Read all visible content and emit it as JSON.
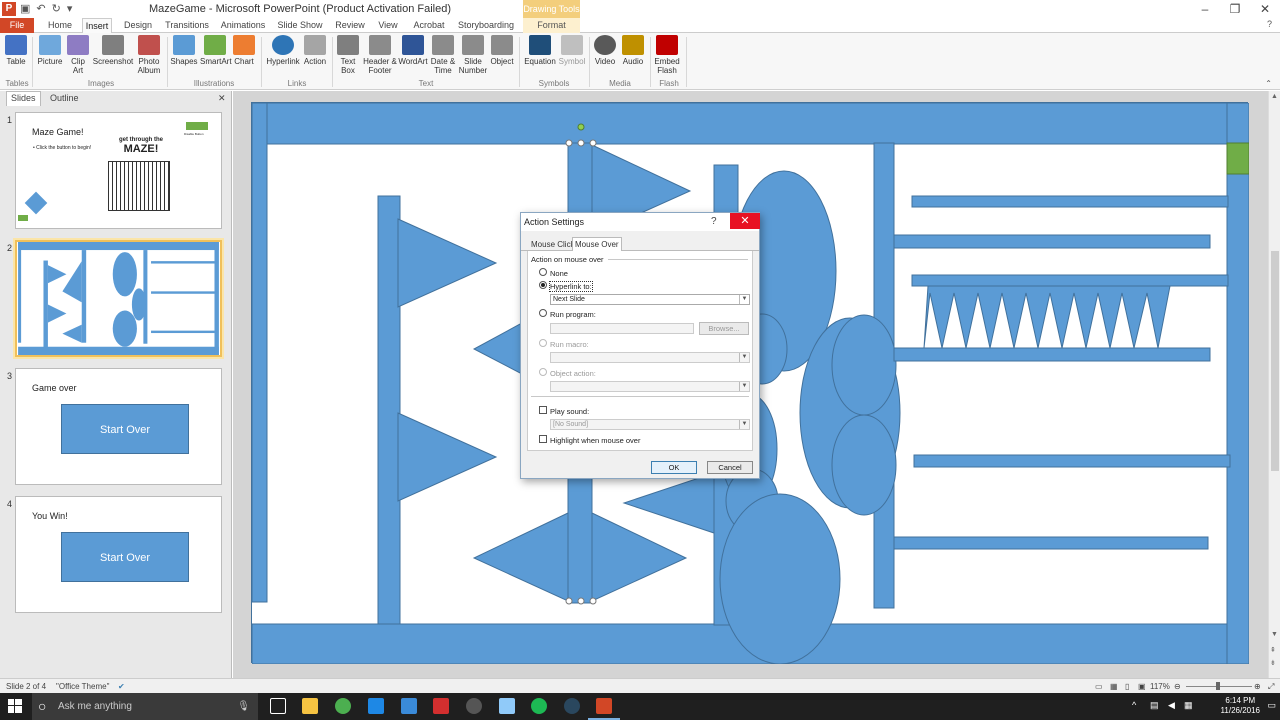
{
  "window": {
    "title": "MazeGame - Microsoft PowerPoint (Product Activation Failed)",
    "drawing_tools": "Drawing Tools",
    "minimize": "–",
    "maximize": "❐",
    "close": "✕"
  },
  "tabs": [
    "File",
    "Home",
    "Insert",
    "Design",
    "Transitions",
    "Animations",
    "Slide Show",
    "Review",
    "View",
    "Acrobat",
    "Storyboarding",
    "Format"
  ],
  "ribbon": {
    "buttons": [
      {
        "label": "Table",
        "color": "#4472c4"
      },
      {
        "label": "Picture",
        "color": "#6fa8dc"
      },
      {
        "label": "Clip Art",
        "color": "#8e7cc3"
      },
      {
        "label": "Screenshot",
        "color": "#7f7f7f"
      },
      {
        "label": "Photo Album",
        "color": "#c0504d"
      },
      {
        "label": "Shapes",
        "color": "#5b9bd5"
      },
      {
        "label": "SmartArt",
        "color": "#70ad47"
      },
      {
        "label": "Chart",
        "color": "#ed7d31"
      },
      {
        "label": "Hyperlink",
        "color": "#2e75b6"
      },
      {
        "label": "Action",
        "color": "#a5a5a5"
      },
      {
        "label": "Text Box",
        "color": "#7f7f7f"
      },
      {
        "label": "Header & Footer",
        "color": "#8b8b8b"
      },
      {
        "label": "WordArt",
        "color": "#2f5597"
      },
      {
        "label": "Date & Time",
        "color": "#8b8b8b"
      },
      {
        "label": "Slide Number",
        "color": "#8b8b8b"
      },
      {
        "label": "Object",
        "color": "#8b8b8b"
      },
      {
        "label": "Equation",
        "color": "#1f4e79"
      },
      {
        "label": "Symbol",
        "color": "#bfbfbf"
      },
      {
        "label": "Video",
        "color": "#595959"
      },
      {
        "label": "Audio",
        "color": "#bf9000"
      },
      {
        "label": "Embed Flash",
        "color": "#c00000"
      }
    ],
    "groups": [
      "Tables",
      "Images",
      "Illustrations",
      "Links",
      "Text",
      "Symbols",
      "Media",
      "Flash"
    ]
  },
  "left_panel": {
    "tabs": [
      "Slides",
      "Outline"
    ],
    "close": "✕",
    "slides": [
      {
        "num": "1",
        "title": "Maze Game!",
        "bullet": "• Click the button to begin!",
        "banner1": "get through the",
        "banner2": "MAZE!",
        "note": "Disable Button"
      },
      {
        "num": "2"
      },
      {
        "num": "3",
        "title": "Game over",
        "button": "Start Over"
      },
      {
        "num": "4",
        "title": "You Win!",
        "button": "Start Over"
      }
    ]
  },
  "dialog": {
    "title": "Action Settings",
    "help": "?",
    "close": "✕",
    "tabs": [
      "Mouse Click",
      "Mouse Over"
    ],
    "section": "Action on mouse over",
    "none": "None",
    "hyperlink": "Hyperlink to:",
    "hyperlink_value": "Next Slide",
    "run_program": "Run program:",
    "browse": "Browse...",
    "run_macro": "Run macro:",
    "object_action": "Object action:",
    "play_sound": "Play sound:",
    "sound_value": "[No Sound]",
    "highlight": "Highlight when mouse over",
    "ok": "OK",
    "cancel": "Cancel"
  },
  "status": {
    "slide": "Slide 2 of 4",
    "theme": "\"Office Theme\"",
    "zoom": "117%"
  },
  "taskbar": {
    "search": "Ask me anything",
    "time": "6:14 PM",
    "date": "11/26/2016"
  },
  "colors": {
    "shape_fill": "#5b9bd5",
    "shape_border": "#41719c",
    "accent": "#d24726",
    "green_button": "#70ad47"
  }
}
